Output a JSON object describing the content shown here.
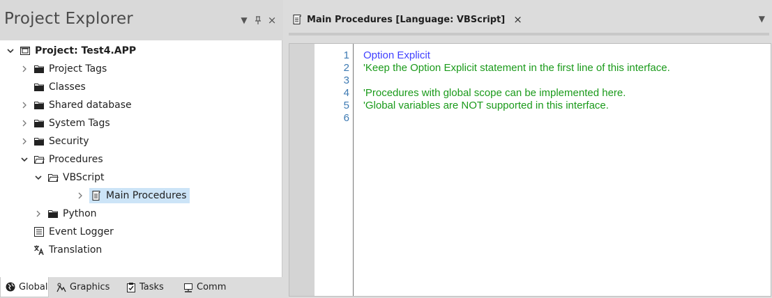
{
  "project_explorer": {
    "title": "Project Explorer",
    "header_buttons": [
      "chevron-down-icon",
      "pin-icon",
      "close-icon"
    ],
    "tree": [
      {
        "label": "Project: Test4.APP",
        "icon": "project-icon",
        "expanded": true
      },
      {
        "label": "Project Tags",
        "icon": "folder-icon",
        "expanded": false
      },
      {
        "label": "Classes",
        "icon": "folder-icon"
      },
      {
        "label": "Shared database",
        "icon": "folder-icon",
        "expanded": false
      },
      {
        "label": "System Tags",
        "icon": "folder-icon",
        "expanded": false
      },
      {
        "label": "Security",
        "icon": "folder-icon",
        "expanded": false
      },
      {
        "label": "Procedures",
        "icon": "folder-open-icon",
        "expanded": true
      },
      {
        "label": "VBScript",
        "icon": "folder-open-icon",
        "expanded": true
      },
      {
        "label": "Main Procedures",
        "icon": "script-icon",
        "expanded": false,
        "selected": true
      },
      {
        "label": "Python",
        "icon": "folder-icon",
        "expanded": false
      },
      {
        "label": "Event Logger",
        "icon": "logger-icon"
      },
      {
        "label": "Translation",
        "icon": "translation-icon"
      }
    ],
    "bottom_tabs": [
      {
        "label": "Global",
        "icon": "globe-icon",
        "active": true
      },
      {
        "label": "Graphics",
        "icon": "graphics-icon"
      },
      {
        "label": "Tasks",
        "icon": "tasks-icon"
      },
      {
        "label": "Comm",
        "icon": "comm-icon"
      }
    ]
  },
  "editor": {
    "tab_title": "Main Procedures [Language: VBScript]",
    "close_glyph": "×",
    "line_numbers": [
      "1",
      "2",
      "3",
      "4",
      "5",
      "6"
    ],
    "lines": [
      {
        "text": "Option Explicit",
        "color": "#4040ff"
      },
      {
        "text": "'Keep the Option Explicit statement in the first line of this interface.",
        "color": "#1a9a1a"
      },
      {
        "text": "",
        "color": "#1a9a1a"
      },
      {
        "text": "'Procedures with global scope can be implemented here.",
        "color": "#1a9a1a"
      },
      {
        "text": "'Global variables are NOT supported in this interface.",
        "color": "#1a9a1a"
      },
      {
        "text": "",
        "color": "#1a9a1a"
      }
    ]
  },
  "colors": {
    "keyword": "#4040ff",
    "comment": "#1a9a1a",
    "line_number": "#3d7ab3",
    "selection": "#cce4f7"
  }
}
